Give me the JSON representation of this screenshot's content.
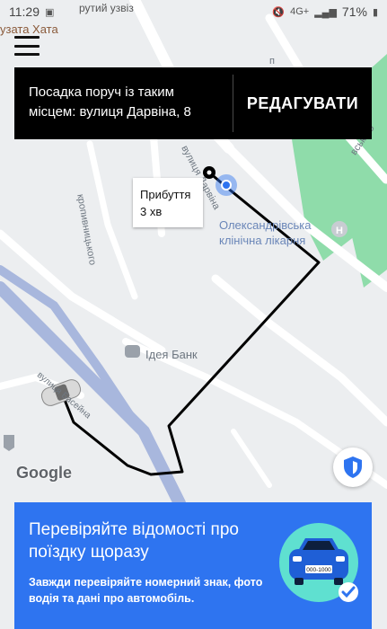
{
  "status_bar": {
    "time": "11:29",
    "battery_percent": "71%",
    "network": "4G+"
  },
  "map": {
    "labels": {
      "top_street": "рутий узвіз",
      "top_left_place": "узата Хата",
      "left_street": "кропивницького",
      "right_street_top": "вського",
      "right_street_mid": "п",
      "pickup_street": "вулиця Дарвіна",
      "hospital": "Олександрівська клінічна лікарня",
      "bank": "Ідея Банк",
      "bottom_left_street": "вулиця Басейна"
    },
    "route_color": "#000000",
    "pickup_marker_color": "#2e74f0"
  },
  "header": {
    "menu_icon": "hamburger-icon"
  },
  "pickup_banner": {
    "text": "Посадка поруч із таким місцем: вулиця Дарвіна, 8",
    "edit_label": "РЕДАГУВАТИ"
  },
  "arrival": {
    "label": "Прибуття",
    "time": "3 хв"
  },
  "google_logo": "Google",
  "safety_button": {
    "icon": "shield-icon"
  },
  "info_card": {
    "title": "Перевіряйте відомості про поїздку щоразу",
    "body": "Завжди перевіряйте номерний знак, фото водія та дані про автомобіль.",
    "plate": "000-1000",
    "accent": "#2e74f0"
  }
}
